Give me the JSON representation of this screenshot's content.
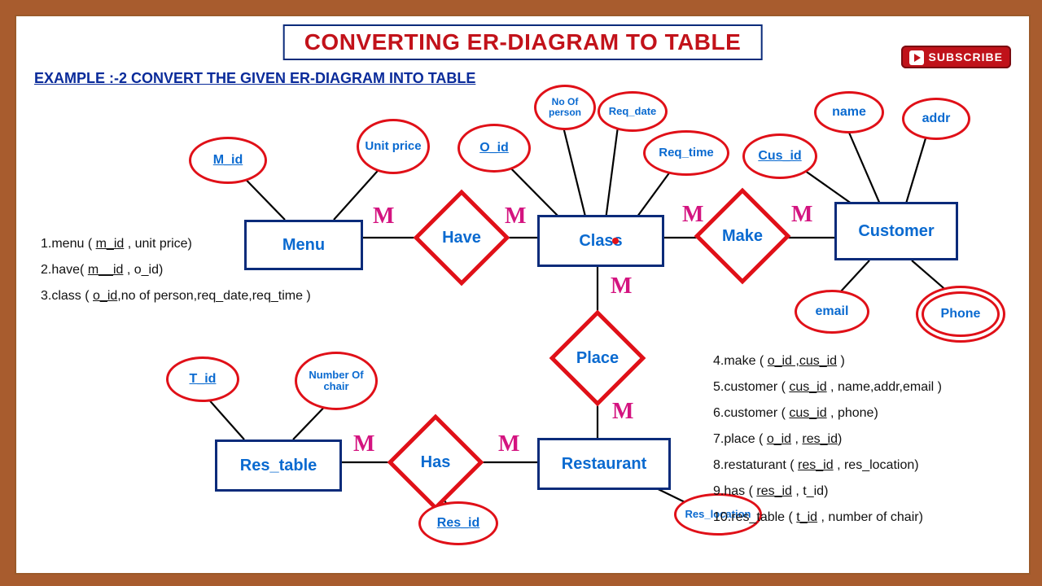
{
  "title": "CONVERTING ER-DIAGRAM TO TABLE",
  "example_label": "EXAMPLE :-2    CONVERT THE  GIVEN ER-DIAGRAM INTO TABLE",
  "subscribe": "SUBSCRIBE",
  "entities": {
    "menu": "Menu",
    "class": "Class",
    "customer": "Customer",
    "res_table": "Res_table",
    "restaurant": "Restaurant"
  },
  "relationships": {
    "have": "Have",
    "make": "Make",
    "place": "Place",
    "has": "Has"
  },
  "attributes": {
    "m_id": "M_id",
    "unit_price": "Unit price",
    "o_id": "O_id",
    "no_of_person": "No Of person",
    "req_date": "Req_date",
    "req_time": "Req_time",
    "cus_id": "Cus_id",
    "name": "name",
    "addr": "addr",
    "email": "email",
    "phone": "Phone",
    "t_id": "T_id",
    "number_of_chair": "Number Of chair",
    "res_id": "Res_id",
    "res_location": "Res_location"
  },
  "cardinality": "M",
  "notes_left": {
    "l1a": "1.menu ( ",
    "l1b": "m_id",
    "l1c": " , unit price)",
    "l2a": "2.have( ",
    "l2b": "m__id",
    "l2c": "   , o_id)",
    "l3a": "3.class ( ",
    "l3b": "o_id",
    "l3c": ",no of person,req_date,req_time )"
  },
  "notes_right": {
    "l4a": "4.make ( ",
    "l4b": "o_id ,cus_id",
    "l4c": " )",
    "l5a": "5.customer ( ",
    "l5b": "cus_id",
    "l5c": " , name,addr,email )",
    "l6a": "6.customer ( ",
    "l6b": "cus_id",
    "l6c": " , phone)",
    "l7a": "7.place ( ",
    "l7b": "o_id",
    "l7c": " , ",
    "l7d": "res_id",
    "l7e": ")",
    "l8a": "8.restaturant ( ",
    "l8b": "res_id",
    "l8c": " , res_location)",
    "l9a": "9.has ( ",
    "l9b": "res_id",
    "l9c": " , t_id)",
    "l10a": "10.res_table ( ",
    "l10b": "t_id",
    "l10c": "  , number of chair)"
  }
}
